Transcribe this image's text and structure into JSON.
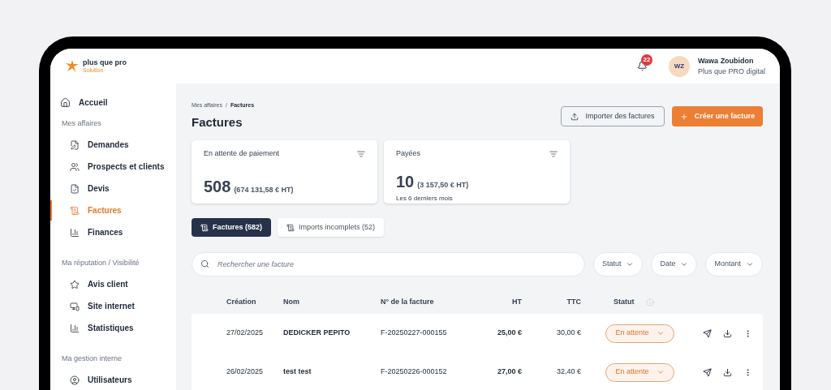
{
  "brand": {
    "name": "plus que pro",
    "sub": "Solution"
  },
  "notifications": {
    "count": "22"
  },
  "user": {
    "initials": "WZ",
    "name": "Wawa Zoubidon",
    "company": "Plus que PRO digital"
  },
  "sidebar": {
    "home": {
      "label": "Accueil",
      "selected": false
    },
    "sections": [
      {
        "title": "Mes affaires",
        "items": [
          {
            "label": "Demandes",
            "selected": false
          },
          {
            "label": "Prospects et clients",
            "selected": false
          },
          {
            "label": "Devis",
            "selected": false
          },
          {
            "label": "Factures",
            "selected": true
          },
          {
            "label": "Finances",
            "selected": false
          }
        ]
      },
      {
        "title": "Ma réputation / Visibilité",
        "items": [
          {
            "label": "Avis client",
            "selected": false
          },
          {
            "label": "Site internet",
            "selected": false
          },
          {
            "label": "Statistiques",
            "selected": false
          }
        ]
      },
      {
        "title": "Ma gestion interne",
        "items": [
          {
            "label": "Utilisateurs",
            "selected": false
          }
        ]
      }
    ]
  },
  "breadcrumb": {
    "parent": "Mes affaires",
    "separator": "/",
    "current": "Factures"
  },
  "title": "Factures",
  "actions": [
    {
      "label": "Importer des factures",
      "kind": "secondary"
    },
    {
      "label": "Créer une facture",
      "kind": "primary"
    }
  ],
  "cards": [
    {
      "title": "En attente de paiement",
      "count": "508",
      "amount": "(674 131,58 € HT)"
    },
    {
      "title": "Payées",
      "count": "10",
      "amount": "(3 157,50 € HT)",
      "note": "Les 6 derniers mois"
    }
  ],
  "tabs": [
    {
      "label": "Factures (582)",
      "selected": true
    },
    {
      "label": "Imports incomplets (52)",
      "selected": false
    }
  ],
  "search": {
    "placeholder": "Rechercher une facture"
  },
  "filters": [
    "Statut",
    "Date",
    "Montant"
  ],
  "table": {
    "columns": [
      "Création",
      "Nom",
      "N° de la facture",
      "HT",
      "TTC",
      "Statut"
    ],
    "rows": [
      {
        "date": "27/02/2025",
        "name": "DEDICKER PEPITO",
        "number": "F-20250227-000155",
        "ht": "25,00 €",
        "ttc": "30,00 €",
        "status": "En attente"
      },
      {
        "date": "26/02/2025",
        "name": "test test",
        "number": "F-20250226-000152",
        "ht": "27,00 €",
        "ttc": "32,40 €",
        "status": "En attente"
      }
    ]
  }
}
